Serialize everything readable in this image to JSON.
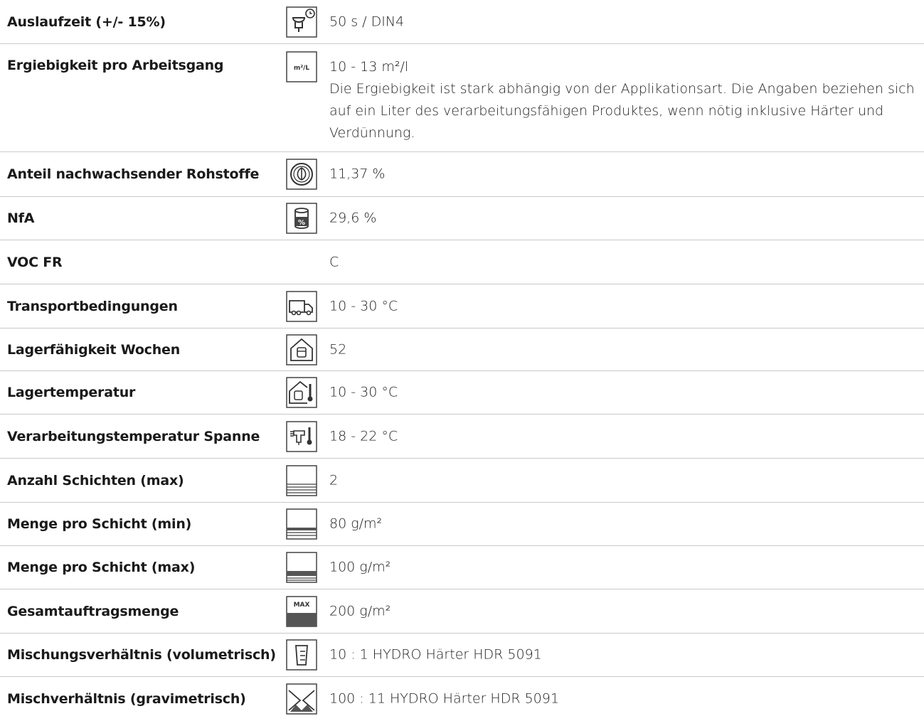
{
  "rows": [
    {
      "label": "Auslaufzeit (+/- 15%)",
      "value": "50 s / DIN4",
      "icon": "efflux-cup-timer-icon"
    },
    {
      "label": "Ergiebigkeit pro Arbeitsgang",
      "value": "10 - 13 m²/l",
      "icon": "coverage-m2-per-l-icon",
      "icon_text": "m²/L",
      "note": "Die Ergiebigkeit ist stark abhängig von der Applikationsart. Die Angaben beziehen sich auf ein Liter des verarbeitungsfähigen Produktes, wenn nötig inklusive Härter und Verdünnung."
    },
    {
      "label": "Anteil nachwachsender Rohstoffe",
      "value": "11,37 %",
      "icon": "renewable-leaf-icon"
    },
    {
      "label": "NfA",
      "value": "29,6 %",
      "icon": "can-percent-icon"
    },
    {
      "label": "VOC FR",
      "value": "C",
      "icon": ""
    },
    {
      "label": "Transportbedingungen",
      "value": "10 - 30 °C",
      "icon": "truck-icon"
    },
    {
      "label": "Lagerfähigkeit Wochen",
      "value": "52",
      "icon": "storage-house-icon"
    },
    {
      "label": "Lagertemperatur",
      "value": "10 - 30 °C",
      "icon": "storage-temperature-icon"
    },
    {
      "label": "Verarbeitungstemperatur Spanne",
      "value": "18 - 22 °C",
      "icon": "spray-gun-thermometer-icon"
    },
    {
      "label": "Anzahl Schichten (max)",
      "value": "2",
      "icon": "layers-icon"
    },
    {
      "label": "Menge pro Schicht (min)",
      "value": "80 g/m²",
      "icon": "layer-amount-min-icon"
    },
    {
      "label": "Menge pro Schicht (max)",
      "value": "100 g/m²",
      "icon": "layer-amount-max-icon"
    },
    {
      "label": "Gesamtauftragsmenge",
      "value": "200 g/m²",
      "icon": "total-amount-max-icon",
      "icon_text": "MAX"
    },
    {
      "label": "Mischungsverhältnis (volumetrisch)",
      "value": "10 : 1 HYDRO Härter HDR 5091",
      "icon": "measuring-cup-icon"
    },
    {
      "label": "Mischverhältnis (gravimetrisch)",
      "value": "100 : 11 HYDRO Härter HDR 5091",
      "icon": "scale-weight-icon"
    }
  ]
}
